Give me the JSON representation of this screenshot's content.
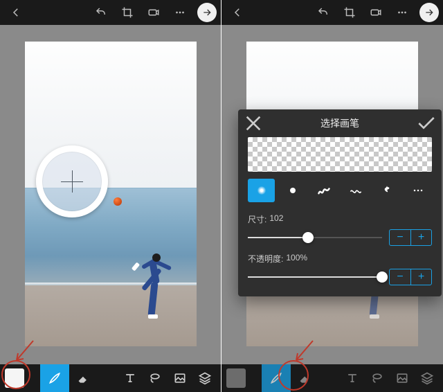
{
  "top": {
    "undo": "undo-icon",
    "crop": "crop-icon",
    "camera": "camera-icon",
    "more": "more-icon",
    "next": "arrow-right-icon"
  },
  "bottom": {
    "swatch": "color-swatch",
    "brush": "brush-icon",
    "eraser": "eraser-icon",
    "text": "text-icon",
    "lasso": "lasso-icon",
    "image": "image-icon",
    "layers": "layers-icon"
  },
  "brush_modal": {
    "title": "选择画笔",
    "size_label": "尺寸:",
    "size_value": "102",
    "size_pct": 45,
    "opacity_label": "不透明度:",
    "opacity_value": "100%",
    "opacity_pct": 100,
    "minus": "−",
    "plus": "+",
    "brushes": [
      "soft-round",
      "hard-round",
      "scribble",
      "wave",
      "splatter",
      "dotted"
    ]
  }
}
